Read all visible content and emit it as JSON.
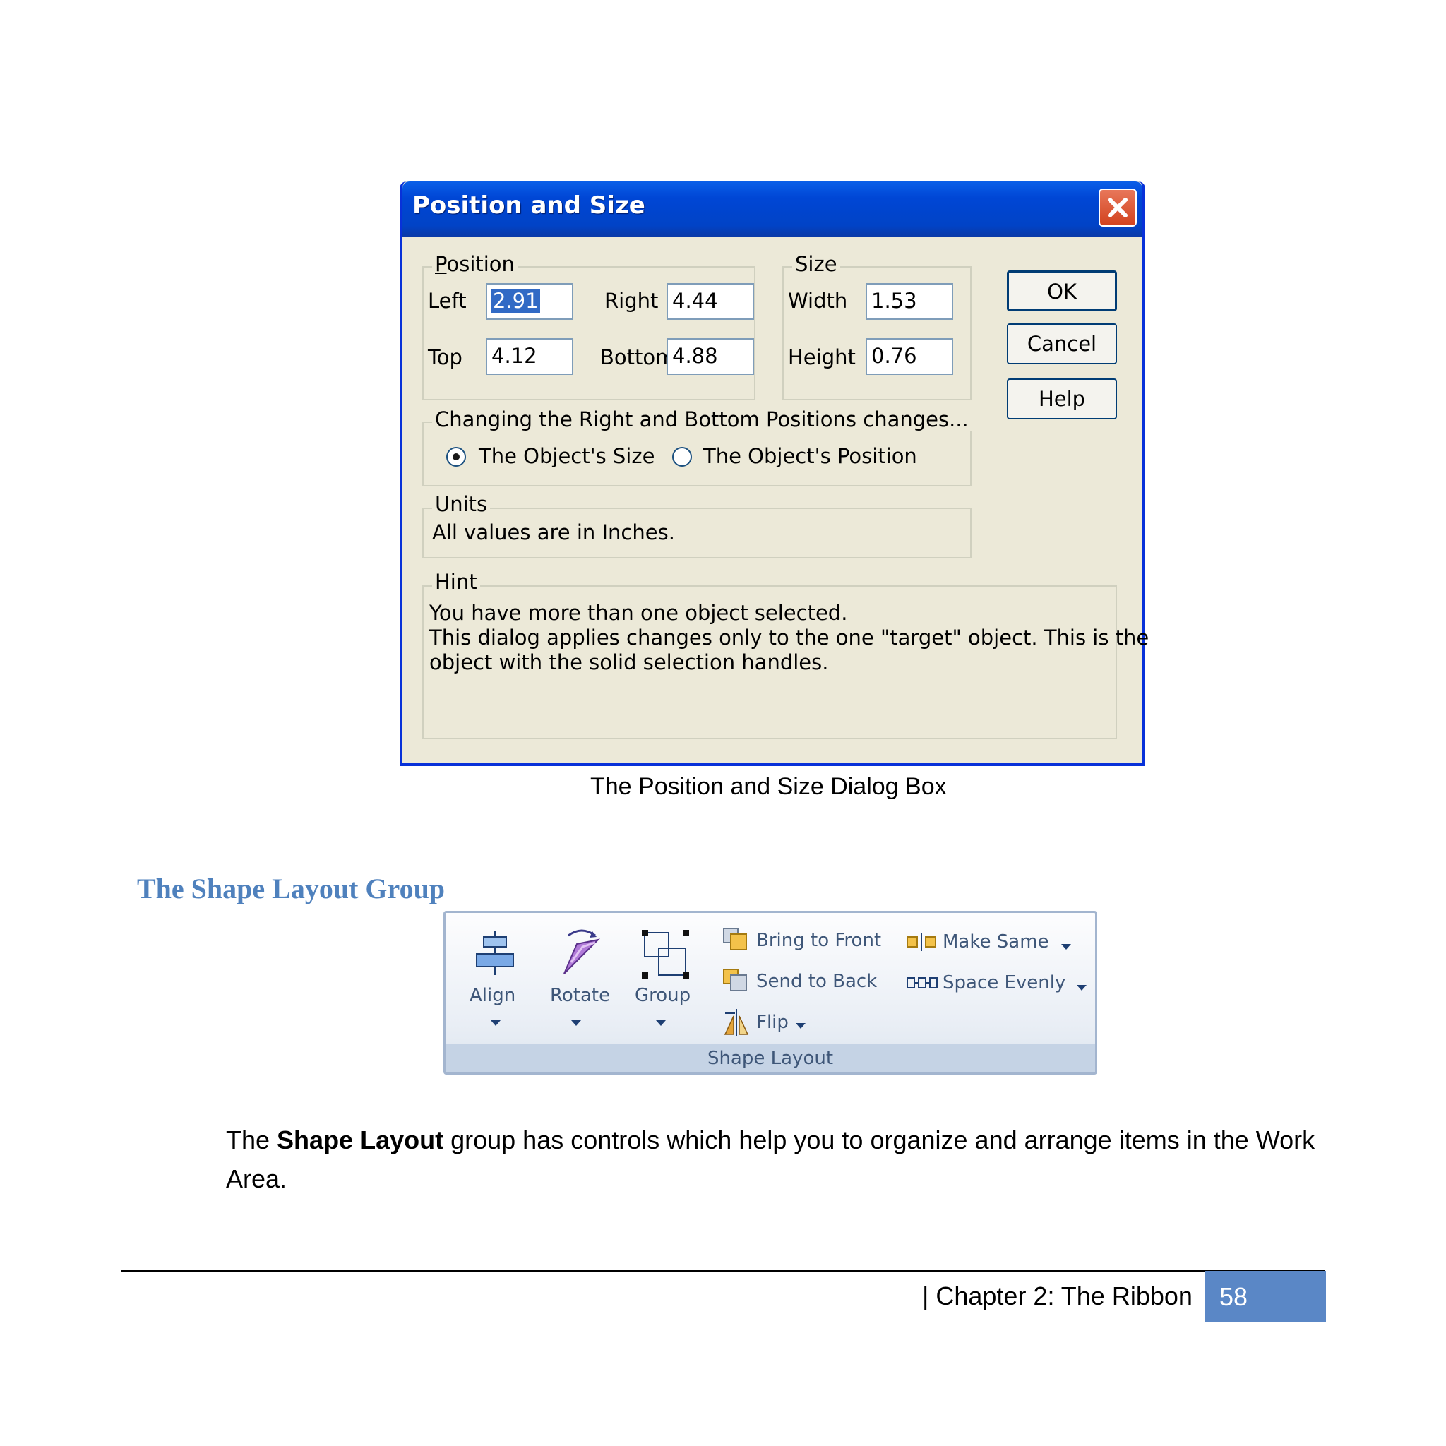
{
  "dialog": {
    "title": "Position and Size",
    "position_group": {
      "legend": "Position",
      "left_label": "Left",
      "left_value": "2.91",
      "right_label": "Right",
      "right_value": "4.44",
      "top_label": "Top",
      "top_value": "4.12",
      "bottom_label": "Bottom",
      "bottom_value": "4.88"
    },
    "size_group": {
      "legend": "Size",
      "width_label": "Width",
      "width_value": "1.53",
      "height_label": "Height",
      "height_value": "0.76"
    },
    "buttons": {
      "ok": "OK",
      "cancel": "Cancel",
      "help": "Help"
    },
    "changing_group": {
      "legend": "Changing the Right and Bottom Positions changes...",
      "option_size": "The Object's Size",
      "option_position": "The Object's Position",
      "selected": "size"
    },
    "units_group": {
      "legend": "Units",
      "text": "All values are in Inches."
    },
    "hint_group": {
      "legend": "Hint",
      "line1": "You have more than one object selected.",
      "line2": "This dialog applies changes only to the one \"target\" object. This is the",
      "line3": "object with the solid selection handles."
    }
  },
  "dialog_caption": "The Position and Size Dialog Box",
  "section_heading": "The Shape Layout Group",
  "ribbon": {
    "group_label": "Shape Layout",
    "align": "Align",
    "rotate": "Rotate",
    "group": "Group",
    "bring_to_front": "Bring to Front",
    "send_to_back": "Send to Back",
    "flip": "Flip",
    "make_same": "Make Same",
    "space_evenly": "Space Evenly"
  },
  "body": {
    "prefix": "The ",
    "bold": "Shape Layout",
    "suffix": " group has controls which help you to organize and arrange items in the Work Area."
  },
  "footer": {
    "chapter": "| Chapter 2: The Ribbon",
    "page": "58"
  }
}
